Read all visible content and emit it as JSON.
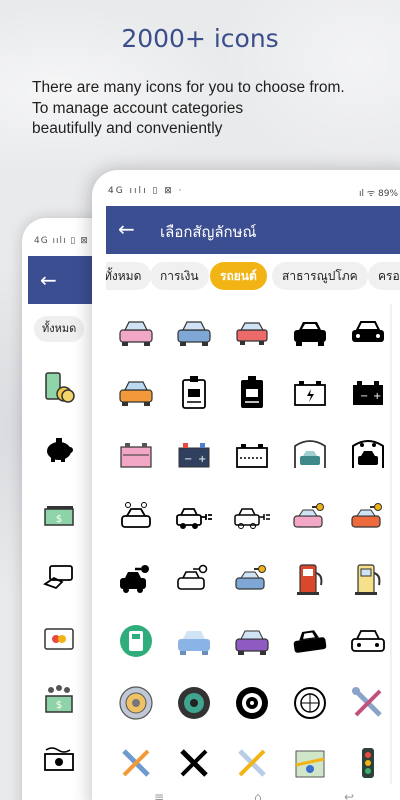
{
  "headline": "2000+ icons",
  "subtext": [
    "There are many icons for you to choose from.",
    "To manage account categories",
    "beautifully and conveniently"
  ],
  "back_phone": {
    "status_left": "4G ıılı ▯ ⊠ ·",
    "back_arrow": "←",
    "chip_all": "ทั้งหมด",
    "icons": [
      "money-stack-icon",
      "piggy-bank-icon",
      "banknote-icon",
      "card-payment-icon",
      "mastercard-icon",
      "people-money-icon",
      "cash-icon"
    ]
  },
  "front_phone": {
    "status_left": "4G ıılı ▯ ⊠ ·",
    "status_right": "ıl ᯤ 89%",
    "back_arrow": "←",
    "title": "เลือกสัญลักษณ์",
    "chips": [
      {
        "label": "ทั้งหมด",
        "selected": false
      },
      {
        "label": "การเงิน",
        "selected": false
      },
      {
        "label": "รถยนต์",
        "selected": true
      },
      {
        "label": "สาธารณูปโภค",
        "selected": false
      },
      {
        "label": "ครอบ",
        "selected": false
      }
    ],
    "icons": [
      "pink-car-icon",
      "blue-car-icon",
      "red-car-front-icon",
      "black-car-icon",
      "car-outline-icon",
      "orange-car-icon",
      "parking-id-card-icon",
      "black-id-card-icon",
      "car-battery-outline-icon",
      "car-battery-icon",
      "pink-battery-icon",
      "blue-battery-icon",
      "battery-outline-icon",
      "car-wash-icon",
      "black-car-wash-icon",
      "car-wash-outline-icon",
      "electric-car-icon",
      "electric-car-outline-icon",
      "car-key-pink-icon",
      "car-key-red-icon",
      "car-key-black-icon",
      "car-key-outline-icon",
      "car-key-blue-icon",
      "fuel-pump-red-icon",
      "fuel-pump-yellow-icon",
      "ev-charger-icon",
      "blue-car-rain-icon",
      "purple-car-icon",
      "car-crash-icon",
      "car-crash-outline-icon",
      "tire-color-icon",
      "tire-green-icon",
      "tire-black-icon",
      "tire-outline-icon",
      "wrench-tools-icon",
      "wrench-blue-icon",
      "wrench-black-icon",
      "wrench-color-icon",
      "map-location-icon",
      "traffic-light-icon"
    ],
    "nav": [
      "≡",
      "⌂",
      "↩"
    ]
  },
  "colors": {
    "appbar": "#3c4e92",
    "selected_chip": "#f2b315",
    "headline": "#3a4e8c"
  }
}
